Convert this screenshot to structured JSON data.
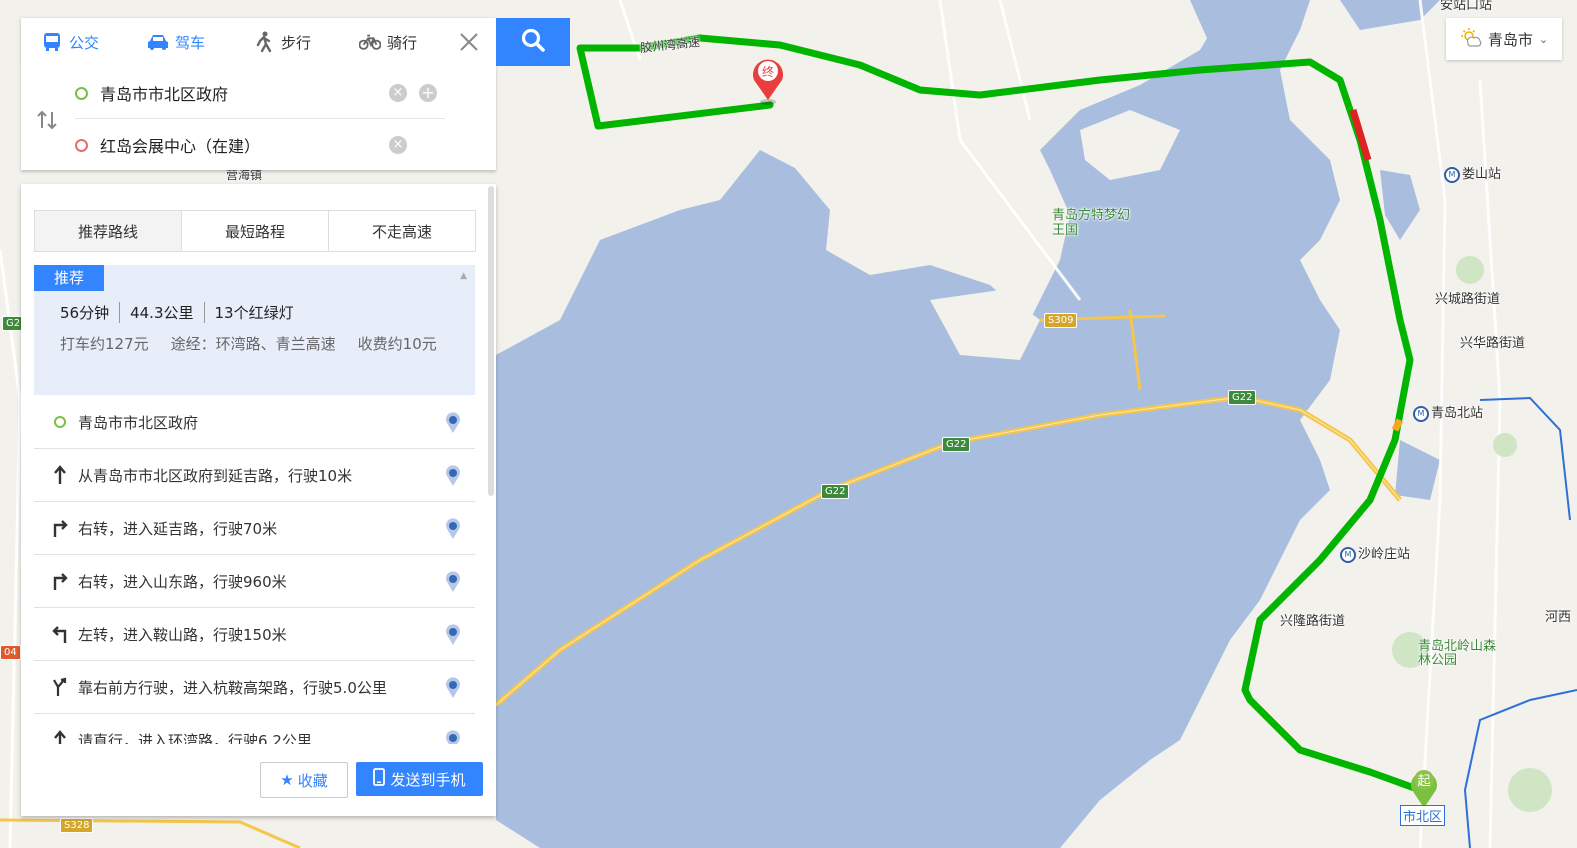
{
  "tabs": [
    {
      "label": "公交",
      "icon": "bus-icon"
    },
    {
      "label": "驾车",
      "icon": "car-icon"
    },
    {
      "label": "步行",
      "icon": "walk-icon"
    },
    {
      "label": "骑行",
      "icon": "bike-icon"
    }
  ],
  "active_tab": "驾车",
  "inputs": {
    "start": "青岛市市北区政府",
    "end": "红岛会展中心（在建）"
  },
  "city": "青岛市",
  "route_tabs": [
    "推荐路线",
    "最短路程",
    "不走高速"
  ],
  "summary": {
    "badge": "推荐",
    "time": "56分钟",
    "distance": "44.3公里",
    "lights": "13个红绿灯",
    "taxi": "打车约127元",
    "via": "途经：环湾路、青兰高速",
    "toll": "收费约10元"
  },
  "steps": [
    {
      "text": "青岛市市北区政府",
      "icon": "start-dot-icon"
    },
    {
      "text": "从青岛市市北区政府到延吉路，行驶10米",
      "icon": "straight-arrow-icon"
    },
    {
      "text": "右转，进入延吉路，行驶70米",
      "icon": "turn-right-icon"
    },
    {
      "text": "右转，进入山东路，行驶960米",
      "icon": "turn-right-icon"
    },
    {
      "text": "左转，进入鞍山路，行驶150米",
      "icon": "turn-left-icon"
    },
    {
      "text": "靠右前方行驶，进入杭鞍高架路，行驶5.0公里",
      "icon": "keep-right-icon"
    },
    {
      "text": "请直行，进入环湾路，行驶6.2公里",
      "icon": "straight-arrow-icon"
    }
  ],
  "footer": {
    "favorite": "收藏",
    "send": "发送到手机"
  },
  "map": {
    "markers": {
      "start": "起",
      "end": "终"
    },
    "labels": {
      "expressway": "胶州湾高速",
      "park": "青岛方特梦幻王国",
      "loushan": "娄山站",
      "xingcheng": "兴城路街道",
      "xinghua": "兴华路街道",
      "qingdaobei": "青岛北站",
      "shaling": "沙岭庄站",
      "xinglong": "兴隆路街道",
      "forest": "青岛北岭山森林公园",
      "shibei": "市北区",
      "hexi": "河西",
      "anshan": "安站口站",
      "haizhen": "营海镇"
    },
    "shields": {
      "s309": "S309",
      "g22": "G22",
      "s328": "S328",
      "g2": "G2",
      "num4": "04"
    },
    "colors": {
      "water": "#a9bedf",
      "land": "#f3f1ec",
      "route": "#00b400",
      "congestion": "#e02222",
      "highway": "#f5c64a"
    }
  }
}
